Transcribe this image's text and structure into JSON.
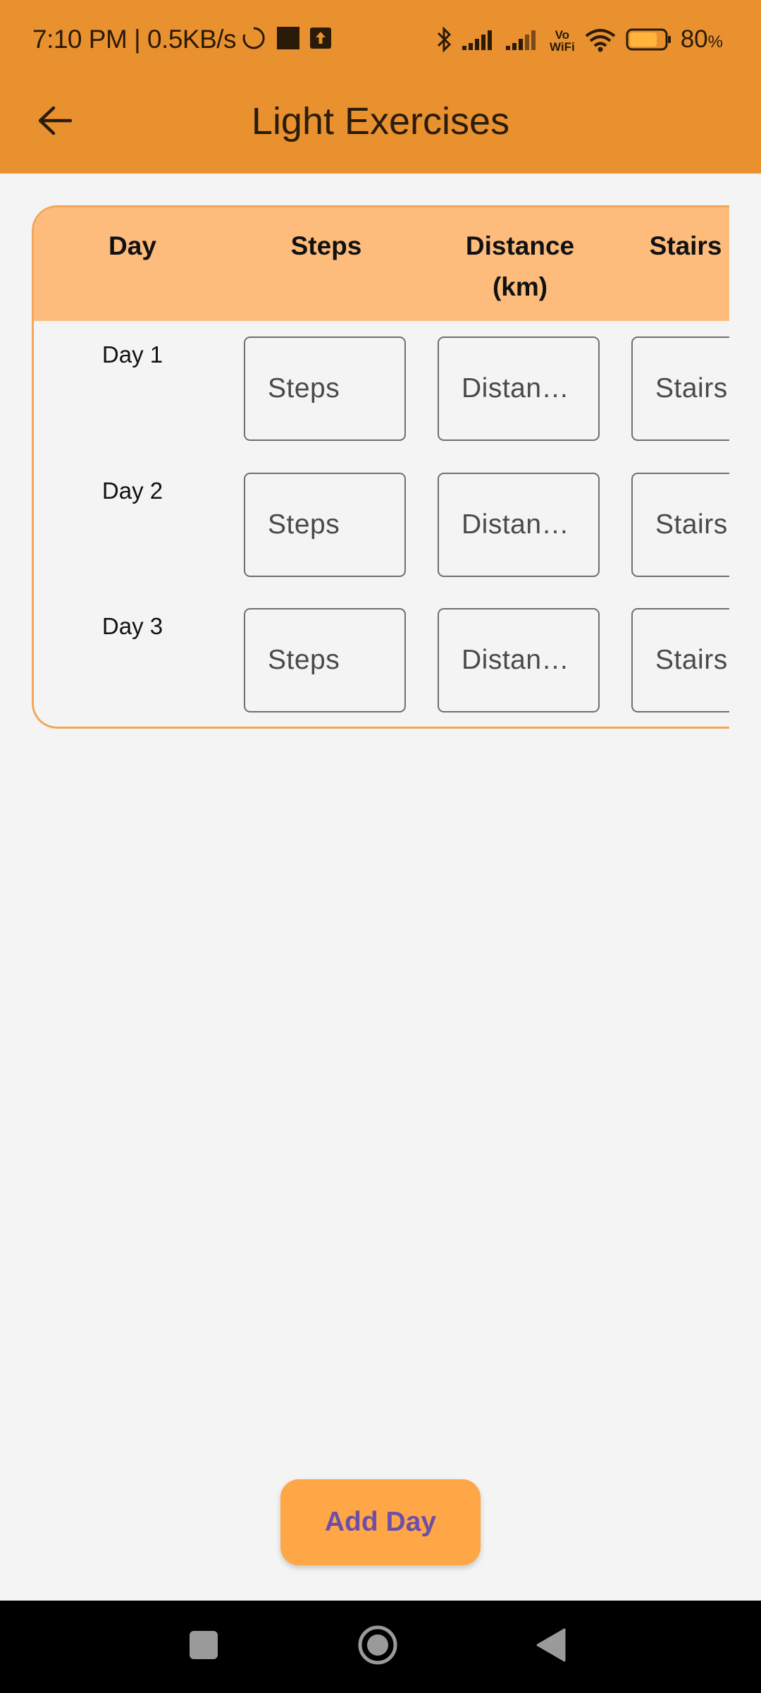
{
  "status_bar": {
    "time": "7:10 PM | 0.5KB/s",
    "battery_percent": "80",
    "battery_unit": "%",
    "vowifi_top": "Vo",
    "vowifi_bottom": "WiFi",
    "battery_level": 0.8,
    "icons": [
      "loading-circle-icon",
      "media-square-icon",
      "upload-icon",
      "bluetooth-icon",
      "signal-icon",
      "signal-icon",
      "vowifi-icon",
      "wifi-icon",
      "battery-icon"
    ]
  },
  "app_bar": {
    "title": "Light Exercises",
    "back_icon": "arrow-left-icon"
  },
  "table": {
    "headers": {
      "day": "Day",
      "steps": "Steps",
      "distance_line1": "Distance",
      "distance_line2": "(km)",
      "stairs": "Stairs"
    },
    "rows": [
      {
        "label": "Day 1",
        "steps_placeholder": "Steps",
        "distance_placeholder": "Distance (km)",
        "stairs_placeholder": "Stairs"
      },
      {
        "label": "Day 2",
        "steps_placeholder": "Steps",
        "distance_placeholder": "Distance (km)",
        "stairs_placeholder": "Stairs"
      },
      {
        "label": "Day 3",
        "steps_placeholder": "Steps",
        "distance_placeholder": "Distance (km)",
        "stairs_placeholder": "Stairs"
      }
    ]
  },
  "actions": {
    "add_day_label": "Add Day"
  },
  "colors": {
    "header_bg": "#e9912f",
    "table_header_bg": "#fdbb7c",
    "table_border": "#f5a659",
    "button_bg": "#ffa646",
    "button_text": "#6e4fa8",
    "page_bg": "#f4f4f4"
  },
  "nav_bar": {
    "icons": [
      "recents-square-icon",
      "home-circle-icon",
      "back-triangle-icon"
    ]
  }
}
